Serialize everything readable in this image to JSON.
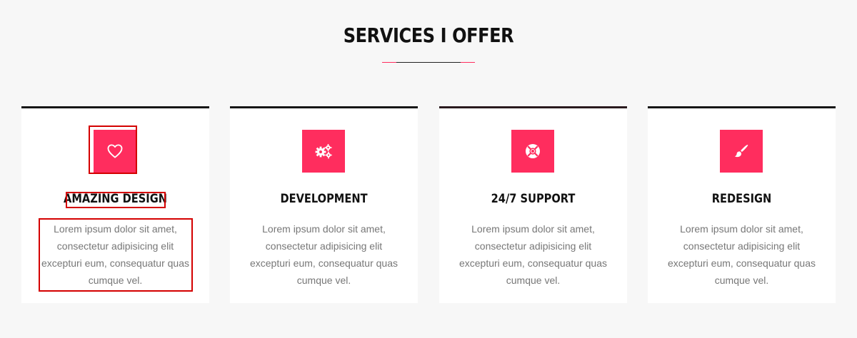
{
  "section": {
    "title": "SERVICES I OFFER"
  },
  "colors": {
    "accent": "#ff2d5e",
    "dark": "#161616",
    "text_muted": "#777777",
    "highlight": "#d40000"
  },
  "services": [
    {
      "title": "AMAZING DESIGN",
      "icon": "heart-icon",
      "text": "Lorem ipsum dolor sit amet, consectetur adipisicing elit excepturi eum, consequatur quas cumque vel."
    },
    {
      "title": "DEVELOPMENT",
      "icon": "gears-icon",
      "text": "Lorem ipsum dolor sit amet, consectetur adipisicing elit excepturi eum, consequatur quas cumque vel."
    },
    {
      "title": "24/7 SUPPORT",
      "icon": "lifebuoy-icon",
      "text": "Lorem ipsum dolor sit amet, consectetur adipisicing elit excepturi eum, consequatur quas cumque vel."
    },
    {
      "title": "REDESIGN",
      "icon": "paintbrush-icon",
      "text": "Lorem ipsum dolor sit amet, consectetur adipisicing elit excepturi eum, consequatur quas cumque vel."
    }
  ]
}
